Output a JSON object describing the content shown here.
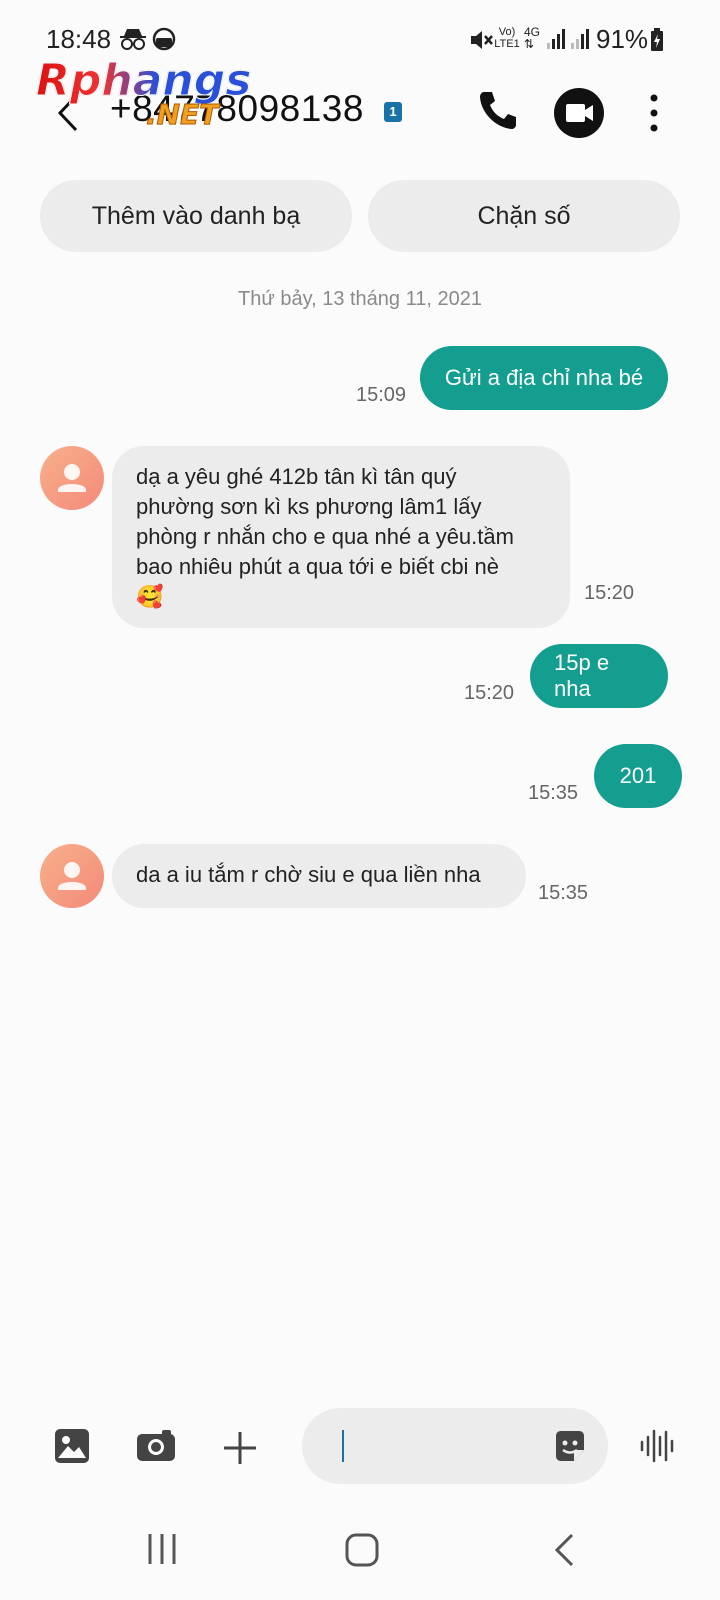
{
  "status_bar": {
    "time": "18:48",
    "battery": "91%",
    "icons": [
      "incognito-icon",
      "do-not-disturb-icon",
      "mute-icon",
      "volte-icon",
      "4g-icon",
      "signal-icon",
      "signal-icon",
      "battery-charging-icon"
    ],
    "volte_label": "Vo) LTE1",
    "network_label": "4G"
  },
  "header": {
    "phone_number": "+84778098138",
    "sim_badge": "1"
  },
  "watermark": {
    "text": "Rphangs",
    "suffix": ".NET"
  },
  "actions": {
    "add_contact": "Thêm vào danh bạ",
    "block_number": "Chặn số"
  },
  "date_separator": "Thứ bảy, 13 tháng 11, 2021",
  "messages": [
    {
      "direction": "out",
      "text": "Gửi a địa chỉ nha bé",
      "time": "15:09"
    },
    {
      "direction": "in",
      "text_lines": [
        "dạ a yêu ghé 412b tân kì tân quý",
        "phường sơn kì ks phương lâm1 lấy",
        "phòng r nhắn cho e qua nhé a yêu.tầm",
        "bao nhiêu phút a qua tới e biết cbi nè"
      ],
      "emoji": "🥰",
      "time": "15:20"
    },
    {
      "direction": "out",
      "text": "15p e nha",
      "time": "15:20"
    },
    {
      "direction": "out",
      "text": "201",
      "time": "15:35"
    },
    {
      "direction": "in",
      "text": "da a iu tắm r chờ siu e qua liền nha",
      "time": "15:35"
    }
  ],
  "composer": {
    "input_value": "",
    "icons": [
      "gallery-icon",
      "camera-icon",
      "plus-icon",
      "sticker-icon",
      "voice-icon"
    ]
  },
  "colors": {
    "outgoing_bubble": "#149e8f",
    "incoming_bubble": "#ececec",
    "background": "#fbfbfb"
  }
}
